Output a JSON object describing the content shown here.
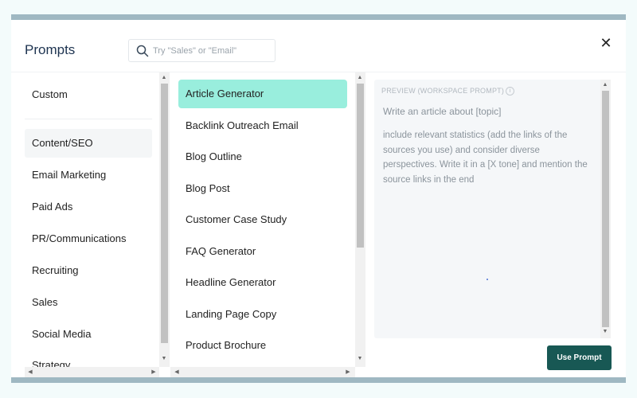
{
  "modal": {
    "title": "Prompts",
    "close_label": "✕"
  },
  "search": {
    "placeholder": "Try \"Sales\" or \"Email\"",
    "value": ""
  },
  "categories": {
    "custom": "Custom",
    "items": [
      "Content/SEO",
      "Email Marketing",
      "Paid Ads",
      "PR/Communications",
      "Recruiting",
      "Sales",
      "Social Media",
      "Strategy"
    ],
    "selected": "Content/SEO"
  },
  "prompts": {
    "items": [
      "Article Generator",
      "Backlink Outreach Email",
      "Blog Outline",
      "Blog Post",
      "Customer Case Study",
      "FAQ Generator",
      "Headline Generator",
      "Landing Page Copy",
      "Product Brochure"
    ],
    "selected": "Article Generator"
  },
  "preview": {
    "label": "PREVIEW (WORKSPACE PROMPT)",
    "info_glyph": "i",
    "line1": "Write an article about [topic]",
    "body": "include relevant statistics (add the links of the sources you use) and consider diverse perspectives. Write it in a [X tone] and mention the source links in the end"
  },
  "actions": {
    "use_prompt": "Use Prompt"
  },
  "colors": {
    "accent": "#99eedd",
    "button": "#185854",
    "stripe": "#9fb8c2"
  }
}
